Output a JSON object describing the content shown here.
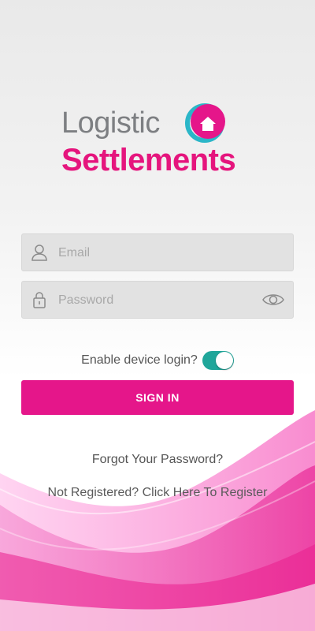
{
  "logo": {
    "line1": "Logistic",
    "line2": "Settlements"
  },
  "form": {
    "email_placeholder": "Email",
    "password_placeholder": "Password",
    "device_login_label": "Enable device login?",
    "device_login_enabled": true,
    "signin_label": "SIGN IN"
  },
  "links": {
    "forgot": "Forgot Your Password?",
    "register": "Not Registered? Click Here To Register"
  },
  "colors": {
    "brand_pink": "#e5168a",
    "brand_gray": "#7d7f82",
    "toggle_teal": "#20a69a",
    "logo_ring_teal": "#2bb6c8"
  },
  "icons": {
    "email": "user-icon",
    "password": "lock-icon",
    "password_toggle": "eye-icon",
    "logo": "house-ring-icon"
  }
}
